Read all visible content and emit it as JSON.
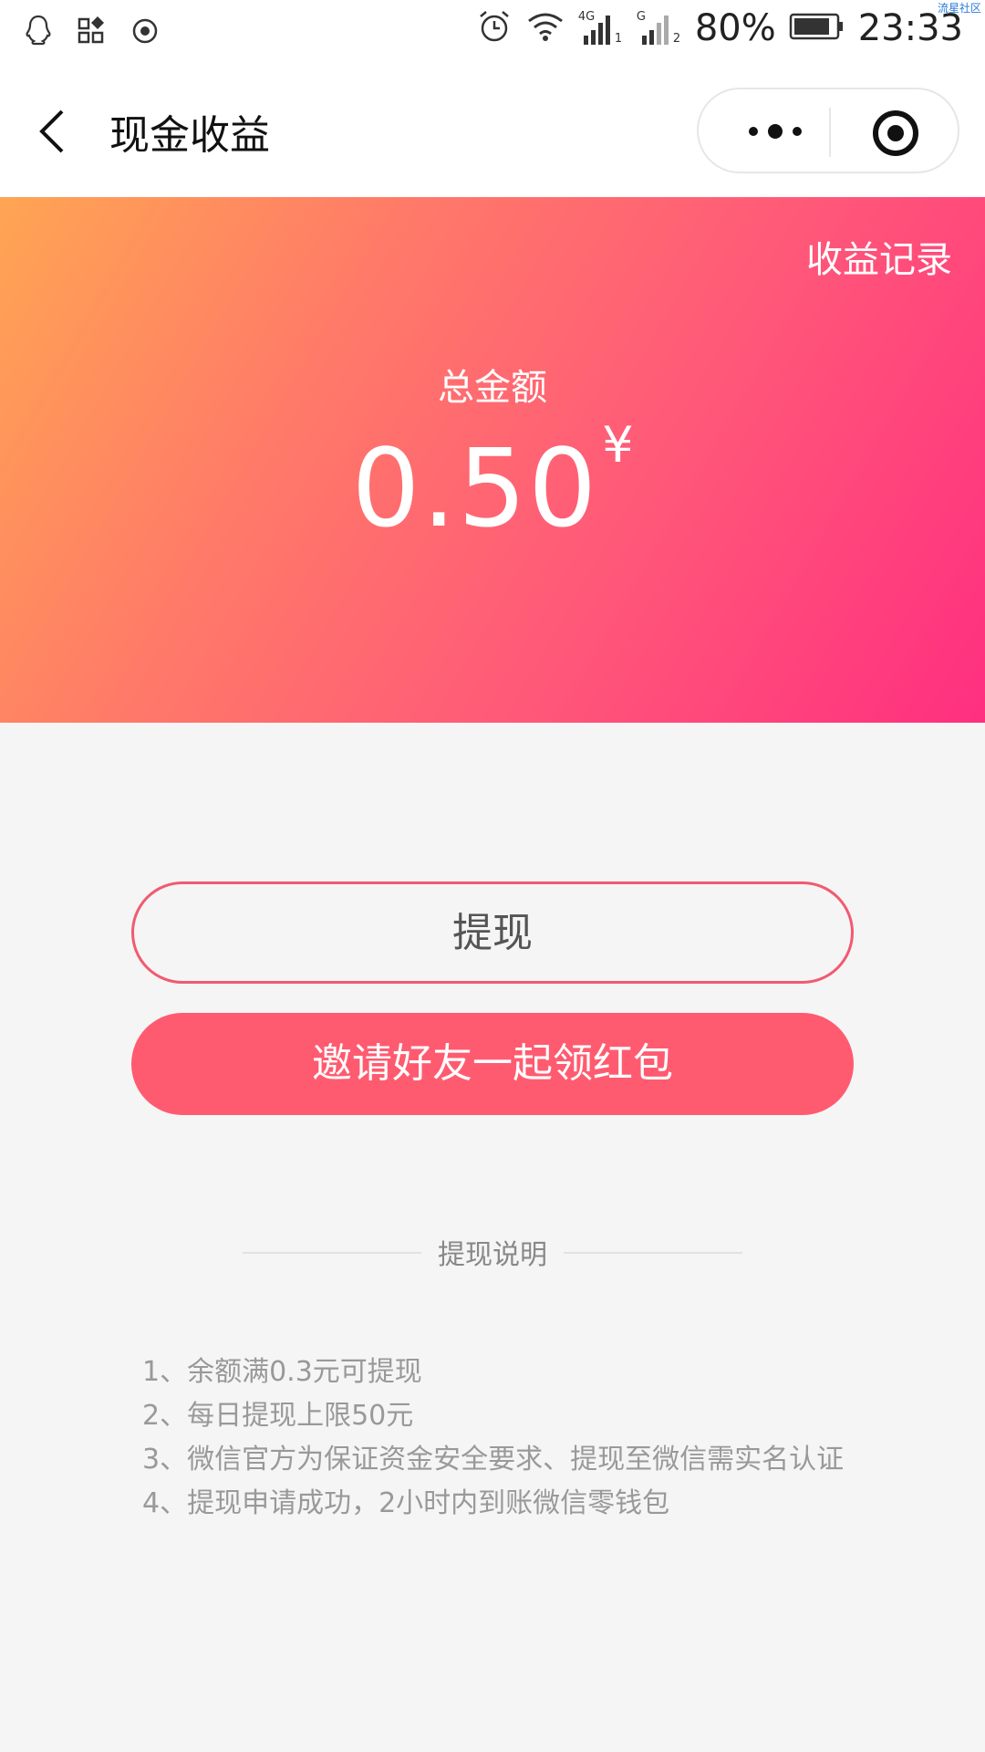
{
  "status_bar": {
    "battery": "80%",
    "time": "23:33",
    "network1": "4G",
    "network2": "G",
    "sim1": "1",
    "sim2": "2",
    "watermark": "流星社区"
  },
  "nav": {
    "title": "现金收益"
  },
  "banner": {
    "records_link": "收益记录",
    "total_label": "总金额",
    "amount": "0.50",
    "currency": "¥",
    "gradient_colors": [
      "#ffa553",
      "#ff5a78",
      "#ff2f80"
    ]
  },
  "buttons": {
    "withdraw": "提现",
    "invite": "邀请好友一起领红包"
  },
  "instructions": {
    "title": "提现说明",
    "items": [
      "1、余额满0.3元可提现",
      "2、每日提现上限50元",
      "3、微信官方为保证资金安全要求、提现至微信需实名认证",
      "4、提现申请成功，2小时内到账微信零钱包"
    ]
  },
  "icons": {
    "status_left": [
      "qq-icon",
      "apps-icon",
      "record-icon"
    ],
    "status_right": [
      "alarm-icon",
      "wifi-icon",
      "signal-icon",
      "signal-icon",
      "battery-icon"
    ],
    "nav": [
      "back-icon",
      "more-icon",
      "target-icon"
    ]
  },
  "colors": {
    "accent": "#ff5b70",
    "outline": "#f15a70",
    "background": "#f5f5f5"
  }
}
